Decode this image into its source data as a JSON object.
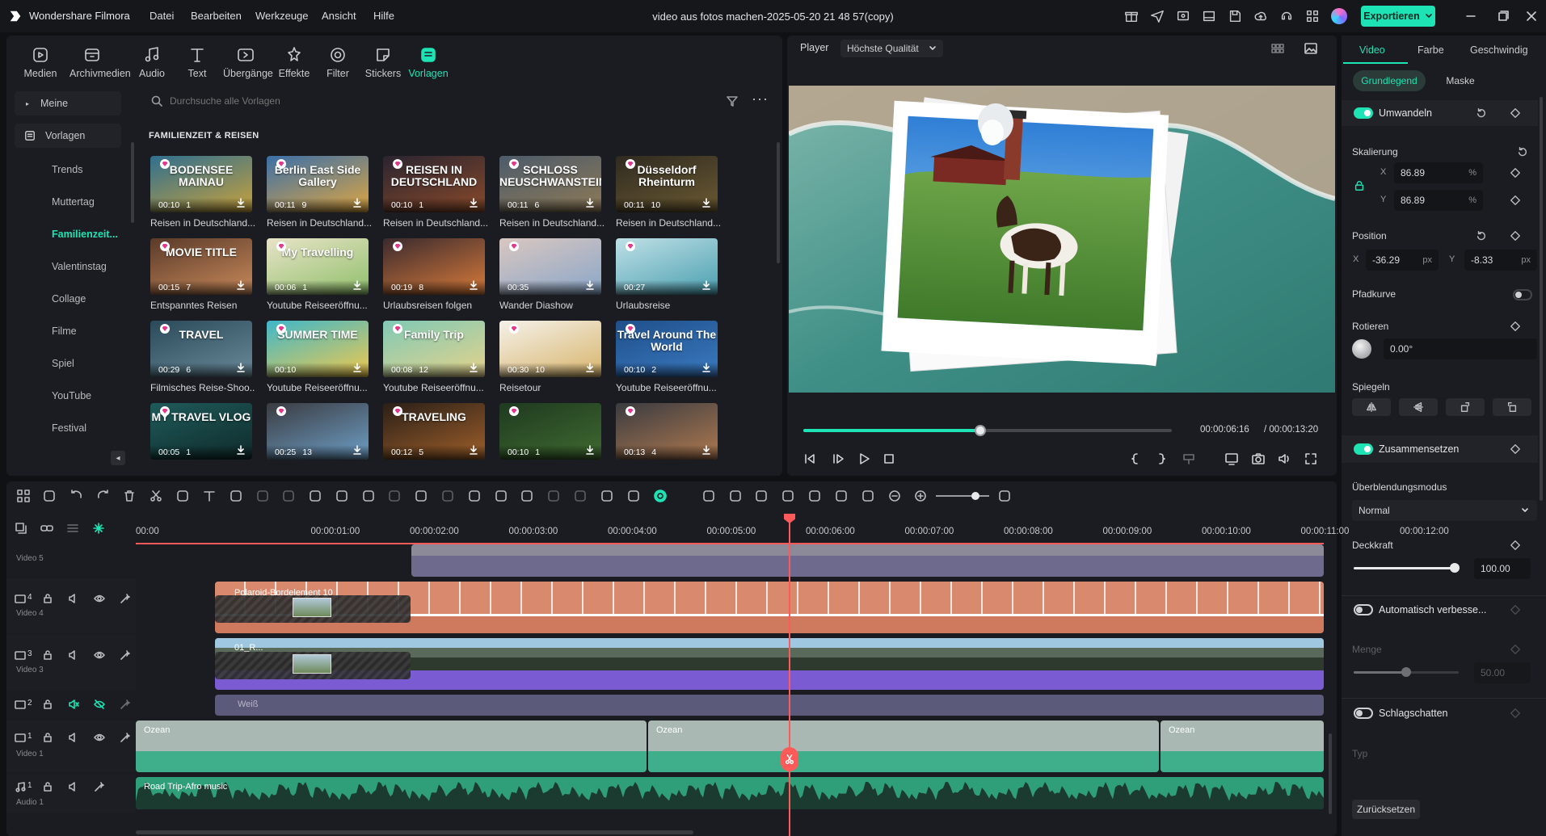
{
  "app": {
    "name": "Wondershare Filmora",
    "doc_title": "video aus fotos machen-2025-05-20 21 48 57(copy)",
    "export_label": "Exportieren"
  },
  "menu": [
    "Datei",
    "Bearbeiten",
    "Werkzeuge",
    "Ansicht",
    "Hilfe"
  ],
  "toolbar": [
    "Medien",
    "Archivmedien",
    "Audio",
    "Text",
    "Übergänge",
    "Effekte",
    "Filter",
    "Stickers",
    "Vorlagen"
  ],
  "sidebar": {
    "top": [
      "Meine",
      "Vorlagen"
    ],
    "subs": [
      "Trends",
      "Muttertag",
      "Familienzeit...",
      "Valentinstag",
      "Collage",
      "Filme",
      "Spiel",
      "YouTube",
      "Festival"
    ]
  },
  "search": {
    "placeholder": "Durchsuche alle Vorlagen"
  },
  "section_title": "FAMILIENZEIT & REISEN",
  "templates": [
    {
      "name": "Reisen in Deutschland...",
      "dur": "00:10",
      "count": "1",
      "text": "BODENSEE MAINAU",
      "c1": "#2f6f8f",
      "c2": "#c9a23c"
    },
    {
      "name": "Reisen in Deutschland...",
      "dur": "00:11",
      "count": "9",
      "text": "Berlin East Side Gallery",
      "c1": "#3b6fa8",
      "c2": "#e0a640"
    },
    {
      "name": "Reisen in Deutschland...",
      "dur": "00:10",
      "count": "1",
      "text": "REISEN IN DEUTSCHLAND",
      "c1": "#2a2430",
      "c2": "#8a4a2a"
    },
    {
      "name": "Reisen in Deutschland...",
      "dur": "00:11",
      "count": "6",
      "text": "SCHLOSS NEUSCHWANSTEIN",
      "c1": "#4d5b6b",
      "c2": "#8e7a56"
    },
    {
      "name": "Reisen in Deutschland...",
      "dur": "00:11",
      "count": "10",
      "text": "Düsseldorf Rheinturm",
      "c1": "#2f2a20",
      "c2": "#6b5a32"
    },
    {
      "name": "Entspanntes Reisen",
      "dur": "00:15",
      "count": "7",
      "text": "MOVIE TITLE",
      "c1": "#5a3a2a",
      "c2": "#c98a5a"
    },
    {
      "name": "Youtube Reiseeröffnu...",
      "dur": "00:06",
      "count": "1",
      "text": "My Travelling",
      "c1": "#e8e3c7",
      "c2": "#8fbf6a"
    },
    {
      "name": "Urlaubsreisen folgen",
      "dur": "00:19",
      "count": "8",
      "text": "",
      "c1": "#3a2a2e",
      "c2": "#d97b3a"
    },
    {
      "name": "Wander Diashow",
      "dur": "00:35",
      "count": "",
      "text": "",
      "c1": "#d9c7c0",
      "c2": "#8aa6c9"
    },
    {
      "name": "Urlaubsreise",
      "dur": "00:27",
      "count": "",
      "text": "",
      "c1": "#bfe0e6",
      "c2": "#4a9fb0"
    },
    {
      "name": "Filmisches Reise-Shoo...",
      "dur": "00:29",
      "count": "6",
      "text": "TRAVEL",
      "c1": "#2a4a5a",
      "c2": "#6a8a9a"
    },
    {
      "name": "Youtube Reiseeröffnu...",
      "dur": "00:10",
      "count": "",
      "text": "SUMMER TIME",
      "c1": "#3fb7c9",
      "c2": "#f2c94c"
    },
    {
      "name": "Youtube Reiseeröffnu...",
      "dur": "00:08",
      "count": "12",
      "text": "Family Trip",
      "c1": "#7fc9b6",
      "c2": "#e6d38a"
    },
    {
      "name": "Reisetour",
      "dur": "00:30",
      "count": "10",
      "text": "",
      "c1": "#f4f1ea",
      "c2": "#d8b46a"
    },
    {
      "name": "Youtube Reiseeröffnu...",
      "dur": "00:10",
      "count": "2",
      "text": "Travel Around The World",
      "c1": "#1f4f8a",
      "c2": "#3a7ac0"
    },
    {
      "name": "",
      "dur": "00:05",
      "count": "1",
      "text": "MY TRAVEL VLOG",
      "c1": "#1f5a5a",
      "c2": "#0f2a2a"
    },
    {
      "name": "",
      "dur": "00:25",
      "count": "13",
      "text": "",
      "c1": "#3a3b40",
      "c2": "#6fa0c8"
    },
    {
      "name": "",
      "dur": "00:12",
      "count": "5",
      "text": "TRAVELING",
      "c1": "#2a1f18",
      "c2": "#a0602a"
    },
    {
      "name": "",
      "dur": "00:10",
      "count": "1",
      "text": "",
      "c1": "#1f3a20",
      "c2": "#3f6a30"
    },
    {
      "name": "",
      "dur": "00:13",
      "count": "4",
      "text": "",
      "c1": "#3a3b40",
      "c2": "#b07a50"
    }
  ],
  "player": {
    "label": "Player",
    "quality": "Höchste Qualität",
    "current": "00:00:06:16",
    "total": "/ 00:00:13:20",
    "progress": 0.48
  },
  "props": {
    "tabs": [
      "Video",
      "Farbe",
      "Geschwindig"
    ],
    "subtabs": [
      "Grundlegend",
      "Maske"
    ],
    "transform": "Umwandeln",
    "scale_label": "Skalierung",
    "scale_x": "86.89",
    "scale_y": "86.89",
    "pct": "%",
    "x_lbl": "X",
    "y_lbl": "Y",
    "position_label": "Position",
    "pos_x": "-36.29",
    "pos_y": "-8.33",
    "px": "px",
    "path_curve": "Pfadkurve",
    "rotate_label": "Rotieren",
    "rotate_value": "0.00°",
    "mirror_label": "Spiegeln",
    "compose": "Zusammensetzen",
    "blend_label": "Überblendungsmodus",
    "blend_value": "Normal",
    "opacity_label": "Deckkraft",
    "opacity_value": "100.00",
    "opacity": 1.0,
    "auto_enhance": "Automatisch verbesse...",
    "amount_label": "Menge",
    "amount_value": "50.00",
    "amount": 0.5,
    "shadow": "Schlagschatten",
    "type_label": "Typ",
    "reset": "Zurücksetzen"
  },
  "timeline": {
    "ruler": [
      "00:00",
      "00:00:01:00",
      "00:00:02:00",
      "00:00:03:00",
      "00:00:04:00",
      "00:00:05:00",
      "00:00:06:00",
      "00:00:07:00",
      "00:00:08:00",
      "00:00:09:00",
      "00:00:10:00",
      "00:00:11:00",
      "00:00:12:00"
    ],
    "tracks": [
      "Video 5",
      "Video 4",
      "Video 3",
      "Video 1",
      "Audio 1"
    ],
    "track_nums": [
      "4",
      "3",
      "2",
      "1",
      "1"
    ],
    "clips": {
      "v4": "Polaroid-Bordelement 10",
      "v3": "01_R...",
      "v2": "Weiß",
      "ocean": "Ozean",
      "audio": "Road Trip-Afro music"
    }
  },
  "colors": {
    "accent": "#1ee3b4",
    "playhead": "#ff5a5a",
    "clip_orange": "#cf7a5e",
    "clip_purple": "#7a5bd1",
    "clip_teal": "#3fae8a"
  }
}
